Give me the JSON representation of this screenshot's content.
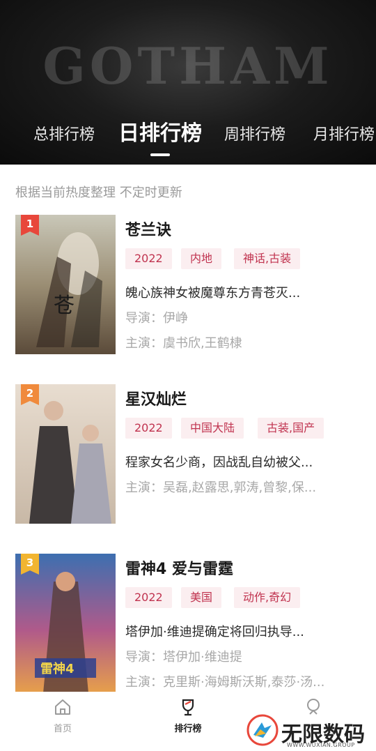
{
  "banner": {
    "text": "GOTHAM"
  },
  "tabs": [
    {
      "label": "总排行榜",
      "active": false
    },
    {
      "label": "日排行榜",
      "active": true
    },
    {
      "label": "周排行榜",
      "active": false
    },
    {
      "label": "月排行榜",
      "active": false
    }
  ],
  "subtitle": "根据当前热度整理 不定时更新",
  "items": [
    {
      "rank": "1",
      "rank_color": "#e8473b",
      "title": "苍兰诀",
      "tags": [
        "2022",
        "内地",
        "神话,古装"
      ],
      "desc": "魄心族神女被魔尊东方青苍灭...",
      "director": "导演：伊峥",
      "cast": "主演：虞书欣,王鹤棣"
    },
    {
      "rank": "2",
      "rank_color": "#f08a3c",
      "title": "星汉灿烂",
      "tags": [
        "2022",
        "中国大陆",
        "古装,国产"
      ],
      "desc": "程家女名少商，因战乱自幼被父...",
      "cast": "主演：吴磊,赵露思,郭涛,曾黎,保..."
    },
    {
      "rank": "3",
      "rank_color": "#f2b531",
      "title": "雷神4 爱与雷霆",
      "tags": [
        "2022",
        "美国",
        "动作,奇幻"
      ],
      "desc": "塔伊加·维迪提确定将回归执导...",
      "director": "导演：塔伊加·维迪提",
      "cast": "主演：克里斯·海姆斯沃斯,泰莎·汤..."
    }
  ],
  "nav": [
    {
      "label": "首页",
      "icon": "home-icon",
      "active": false
    },
    {
      "label": "排行榜",
      "icon": "trophy-icon",
      "active": true
    },
    {
      "label": "",
      "icon": "profile-icon",
      "active": false
    }
  ],
  "watermark": {
    "text": "无限数码",
    "sub": "WWW.WUXIAN.GROUP"
  }
}
